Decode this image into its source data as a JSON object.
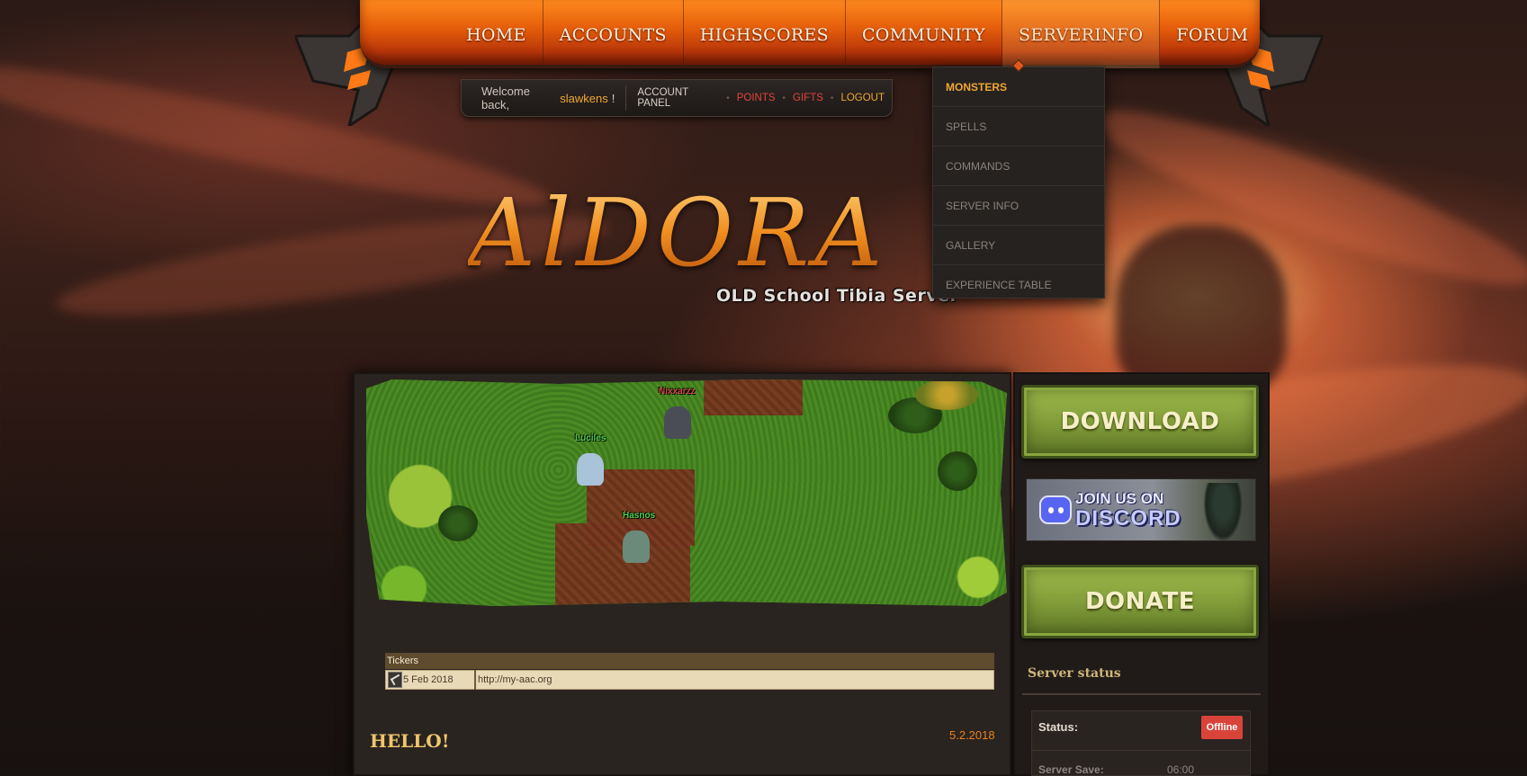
{
  "nav": {
    "items": [
      {
        "label": "HOME"
      },
      {
        "label": "ACCOUNTS"
      },
      {
        "label": "HIGHSCORES"
      },
      {
        "label": "COMMUNITY"
      },
      {
        "label": "SERVERINFO"
      },
      {
        "label": "FORUM"
      }
    ],
    "active": "SERVERINFO"
  },
  "user_bar": {
    "welcome": "Welcome back,",
    "username": "slawkens",
    "suffix": "!",
    "links": [
      {
        "label": "ACCOUNT PANEL"
      },
      {
        "label": "POINTS"
      },
      {
        "label": "GIFTS"
      },
      {
        "label": "LOGOUT"
      }
    ]
  },
  "dropdown": {
    "items": [
      {
        "label": "MONSTERS"
      },
      {
        "label": "SPELLS"
      },
      {
        "label": "COMMANDS"
      },
      {
        "label": "SERVER INFO"
      },
      {
        "label": "GALLERY"
      },
      {
        "label": "EXPERIENCE TABLE"
      }
    ]
  },
  "logo": {
    "title": "AlDORA",
    "subtitle": "OLD School Tibia Server"
  },
  "game_view": {
    "characters": [
      {
        "name": "Nixxarzz",
        "color": "#d04545"
      },
      {
        "name": "Luciles",
        "color": "#4fcf4f"
      },
      {
        "name": "Hasnos",
        "color": "#4fcf4f"
      }
    ]
  },
  "tickers": {
    "header": "Tickers",
    "rows": [
      {
        "date": "5 Feb 2018",
        "text": "http://my-aac.org"
      }
    ]
  },
  "news": {
    "title": "HELLO!",
    "date": "5.2.2018"
  },
  "sidebar": {
    "download_label": "DOWNLOAD",
    "discord_line1": "JOIN US ON",
    "discord_line2": "DISCORD",
    "donate_label": "DONATE",
    "server_status_title": "Server status",
    "status_label": "Status:",
    "status_value": "Offline",
    "server_save_label": "Server Save:",
    "server_save_value": "06:00"
  },
  "colors": {
    "nav_orange": "#e35c0a",
    "accent_orange": "#f0a733",
    "status_offline": "#d9443a",
    "button_green": "#7f9a38"
  }
}
